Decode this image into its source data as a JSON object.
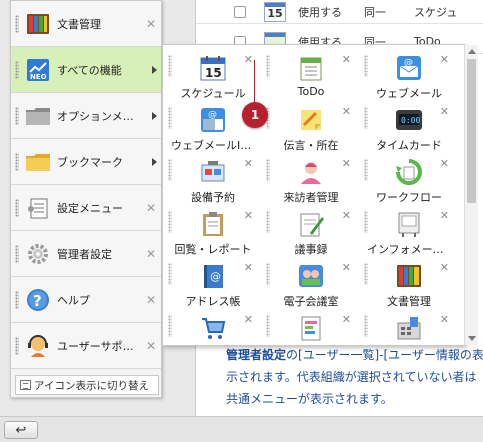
{
  "background": {
    "rows": [
      {
        "date": "15",
        "col1": "使用する",
        "col2": "同一",
        "col3": "スケジュ"
      },
      {
        "date": "",
        "col1": "使用する",
        "col2": "同一",
        "col3": "ToDo"
      }
    ],
    "description_bold": "管理者設定",
    "description": "の[ユーザー一覧]-[ユーザー情報の表示されます。代表組織が選択されていない者は共通メニューが表示されます。"
  },
  "menu": {
    "items": [
      {
        "label": "文書管理",
        "icon": "ledger-icon",
        "has_close": true,
        "has_arrow": false
      },
      {
        "label": "すべての機能",
        "icon": "neo-apps-icon",
        "has_close": false,
        "has_arrow": true
      },
      {
        "label": "オプションメニュー",
        "icon": "folder-gray-icon",
        "has_close": false,
        "has_arrow": true
      },
      {
        "label": "ブックマーク",
        "icon": "folder-yellow-icon",
        "has_close": false,
        "has_arrow": true
      },
      {
        "label": "設定メニュー",
        "icon": "settings-list-icon",
        "has_close": true,
        "has_arrow": false
      },
      {
        "label": "管理者設定",
        "icon": "gear-icon",
        "has_close": true,
        "has_arrow": false
      },
      {
        "label": "ヘルプ",
        "icon": "help-icon",
        "has_close": true,
        "has_arrow": false
      },
      {
        "label": "ユーザーサポート",
        "icon": "support-icon",
        "has_close": true,
        "has_arrow": false
      }
    ],
    "footer_label": "アイコン表示に切り替え"
  },
  "apps": [
    {
      "label": "スケジュール",
      "icon": "calendar-icon",
      "date": "15"
    },
    {
      "label": "ToDo",
      "icon": "todo-icon"
    },
    {
      "label": "ウェブメール",
      "icon": "webmail-icon"
    },
    {
      "label": "ウェブメールIMAP",
      "icon": "webmail-imap-icon"
    },
    {
      "label": "伝言・所在",
      "icon": "memo-icon"
    },
    {
      "label": "タイムカード",
      "icon": "timecard-icon",
      "time": "0:00"
    },
    {
      "label": "設備予約",
      "icon": "facility-icon"
    },
    {
      "label": "来訪者管理",
      "icon": "visitor-icon"
    },
    {
      "label": "ワークフロー",
      "icon": "workflow-icon"
    },
    {
      "label": "回覧・レポート",
      "icon": "circular-icon"
    },
    {
      "label": "議事録",
      "icon": "minutes-icon"
    },
    {
      "label": "インフォメーション",
      "icon": "information-icon"
    },
    {
      "label": "アドレス帳",
      "icon": "address-book-icon"
    },
    {
      "label": "電子会議室",
      "icon": "forum-icon"
    },
    {
      "label": "文書管理",
      "icon": "ledger-icon"
    },
    {
      "label": "",
      "icon": "cart-icon"
    },
    {
      "label": "",
      "icon": "document-icon"
    },
    {
      "label": "",
      "icon": "calculator-icon"
    }
  ],
  "badge": "1",
  "colors": {
    "active_menu": "#d7f0b9",
    "badge": "#b8202e",
    "link_text": "#1f4f9a"
  }
}
